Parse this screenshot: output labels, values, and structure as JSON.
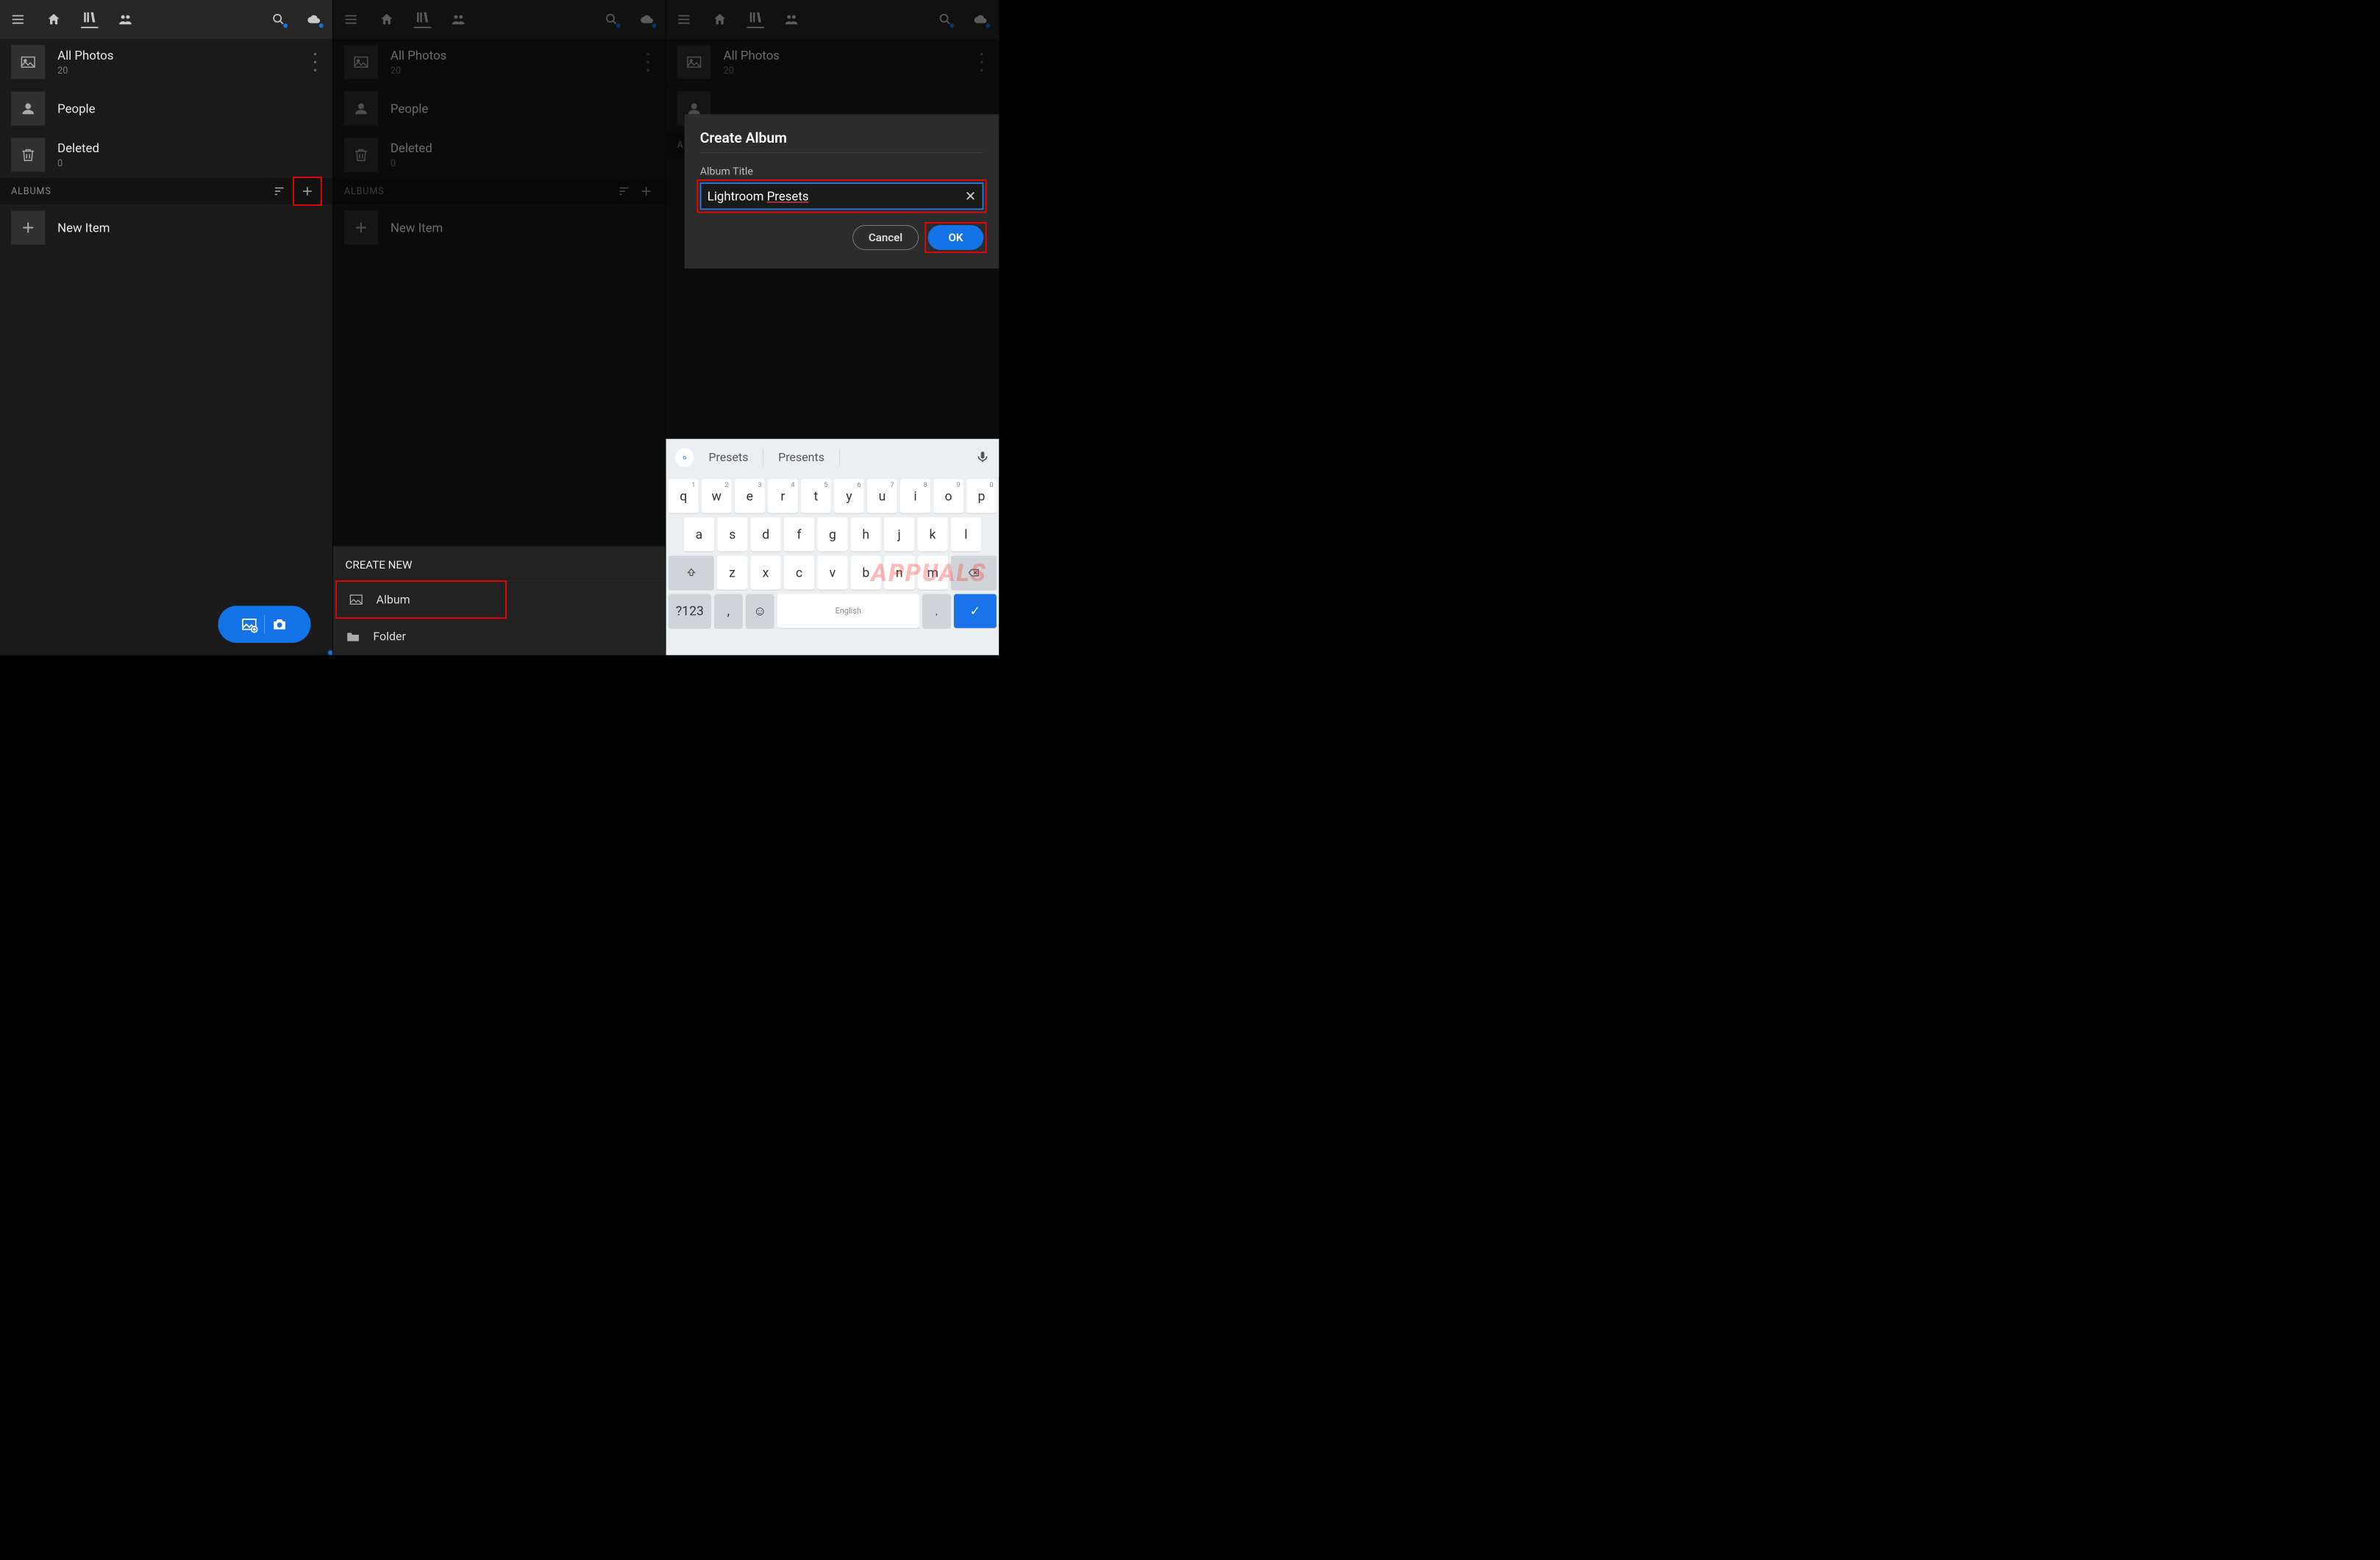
{
  "panel1": {
    "all_photos_title": "All Photos",
    "all_photos_count": "20",
    "people_title": "People",
    "deleted_title": "Deleted",
    "deleted_count": "0",
    "albums_label": "ALBUMS",
    "new_item_label": "New Item"
  },
  "panel2": {
    "all_photos_title": "All Photos",
    "all_photos_count": "20",
    "people_title": "People",
    "deleted_title": "Deleted",
    "deleted_count": "0",
    "albums_label": "ALBUMS",
    "new_item_label": "New Item",
    "sheet_title": "CREATE NEW",
    "sheet_album": "Album",
    "sheet_folder": "Folder"
  },
  "panel3": {
    "all_photos_title": "All Photos",
    "all_photos_count": "20",
    "albums_label": "AL",
    "dialog_title": "Create Album",
    "field_label": "Album Title",
    "input_value_plain": "Lightroom ",
    "input_value_underlined": "Presets",
    "cancel": "Cancel",
    "ok": "OK",
    "sugg1": "Presets",
    "sugg2": "Presents",
    "kbd_r1": [
      [
        "q",
        "1"
      ],
      [
        "w",
        "2"
      ],
      [
        "e",
        "3"
      ],
      [
        "r",
        "4"
      ],
      [
        "t",
        "5"
      ],
      [
        "y",
        "6"
      ],
      [
        "u",
        "7"
      ],
      [
        "i",
        "8"
      ],
      [
        "o",
        "9"
      ],
      [
        "p",
        "0"
      ]
    ],
    "kbd_r2": [
      "a",
      "s",
      "d",
      "f",
      "g",
      "h",
      "j",
      "k",
      "l"
    ],
    "kbd_r3": [
      "z",
      "x",
      "c",
      "v",
      "b",
      "n",
      "m"
    ],
    "kbd_sym": "?123",
    "kbd_lang": "English"
  },
  "watermark": "APPUALS"
}
